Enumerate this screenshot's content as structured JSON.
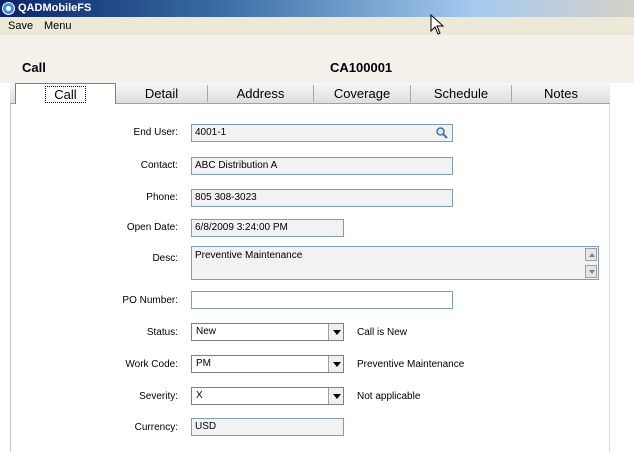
{
  "window": {
    "title": "QADMobileFS"
  },
  "menu": {
    "save": "Save",
    "menu": "Menu"
  },
  "header": {
    "title": "Call",
    "record_id": "CA100001"
  },
  "tabs": [
    "Call",
    "Detail",
    "Address",
    "Coverage",
    "Schedule",
    "Notes"
  ],
  "form": {
    "end_user": {
      "label": "End User:",
      "value": "4001-1"
    },
    "contact": {
      "label": "Contact:",
      "value": "ABC Distribution A"
    },
    "phone": {
      "label": "Phone:",
      "value": "805 308-3023"
    },
    "open_date": {
      "label": "Open Date:",
      "value": "6/8/2009 3:24:00 PM"
    },
    "desc": {
      "label": "Desc:",
      "value": "Preventive Maintenance"
    },
    "po_number": {
      "label": "PO Number:",
      "value": ""
    },
    "status": {
      "label": "Status:",
      "value": "New",
      "note": "Call is New"
    },
    "work_code": {
      "label": "Work Code:",
      "value": "PM",
      "note": "Preventive Maintenance"
    },
    "severity": {
      "label": "Severity:",
      "value": "X",
      "note": "Not applicable"
    },
    "currency": {
      "label": "Currency:",
      "value": "USD"
    }
  },
  "colors": {
    "titlebar": "#0a246a",
    "menubar": "#ece9d8",
    "field_border": "#7f9db9"
  }
}
